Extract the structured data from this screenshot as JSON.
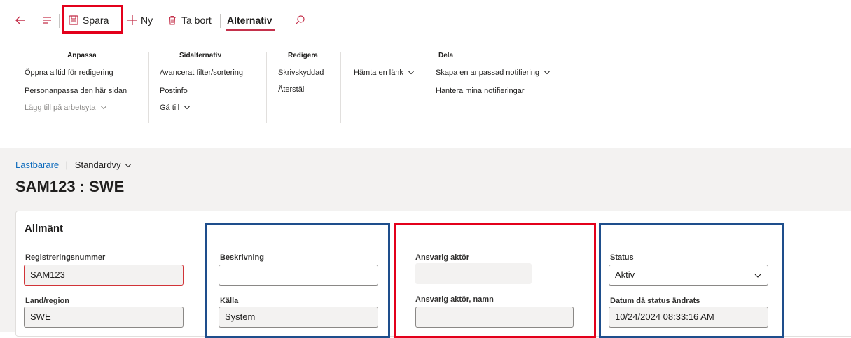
{
  "toolbar": {
    "save_label": "Spara",
    "new_label": "Ny",
    "delete_label": "Ta bort",
    "options_tab_label": "Alternativ"
  },
  "ribbon": {
    "groups": [
      {
        "title": "Anpassa",
        "items": [
          "Öppna alltid för redigering",
          "Personanpassa den här sidan",
          "Lägg till på arbetsyta"
        ]
      },
      {
        "title": "Sidalternativ",
        "items": [
          "Avancerat filter/sortering",
          "Postinfo",
          "Gå till"
        ]
      },
      {
        "title": "Redigera",
        "items": [
          "Skrivskyddad",
          "Återställ"
        ]
      },
      {
        "title": "Dela",
        "items": [
          "Hämta en länk",
          "Skapa en anpassad notifiering",
          "Hantera mina notifieringar"
        ]
      }
    ]
  },
  "breadcrumb": {
    "link": "Lastbärare",
    "separator": "|",
    "view": "Standardvy"
  },
  "page": {
    "title": "SAM123 : SWE"
  },
  "card": {
    "header": "Allmänt",
    "fields": {
      "registration_label": "Registreringsnummer",
      "registration_value": "SAM123",
      "country_label": "Land/region",
      "country_value": "SWE",
      "description_label": "Beskrivning",
      "description_value": "",
      "source_label": "Källa",
      "source_value": "System",
      "actor_label": "Ansvarig aktör",
      "actor_value": "",
      "actor_name_label": "Ansvarig aktör, namn",
      "actor_name_value": "",
      "status_label": "Status",
      "status_value": "Aktiv",
      "status_date_label": "Datum då status ändrats",
      "status_date_value": "10/24/2024 08:33:16 AM"
    }
  },
  "colors": {
    "highlight_red": "#e3001b",
    "highlight_blue": "#1e4e8c",
    "link_blue": "#0f6cbd",
    "tab_accent": "#c4314b"
  }
}
